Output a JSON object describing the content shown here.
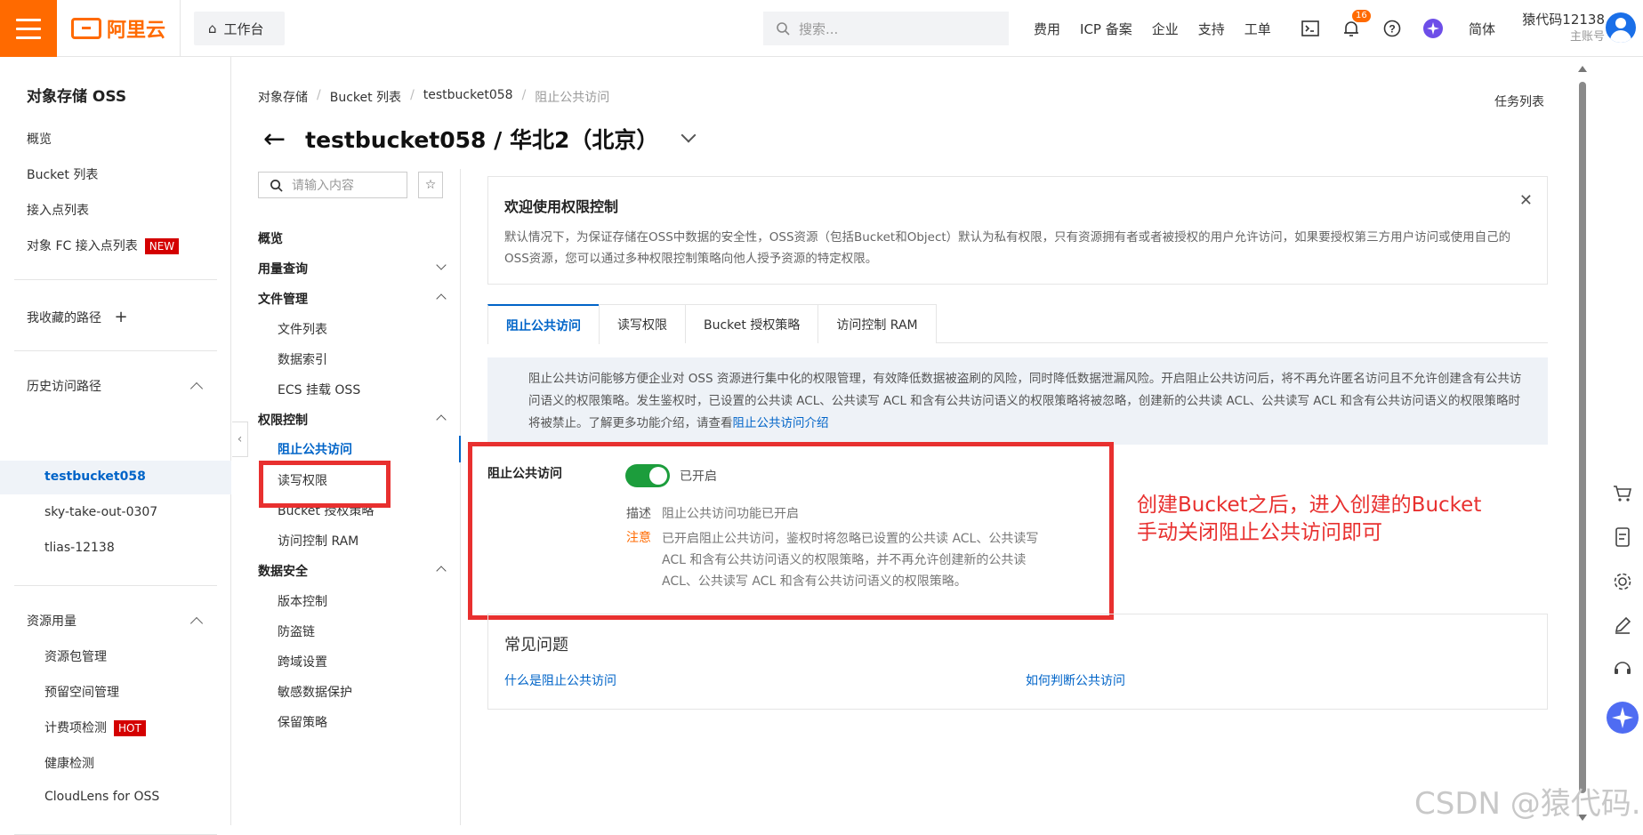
{
  "topbar": {
    "logo_text": "阿里云",
    "workbench": "工作台",
    "search_placeholder": "搜索...",
    "links": [
      "费用",
      "ICP 备案",
      "企业",
      "支持",
      "工单"
    ],
    "notification_count": "16",
    "language": "简体",
    "username": "猿代码12138",
    "account_type": "主账号"
  },
  "sidebar": {
    "title": "对象存储 OSS",
    "items": [
      "概览",
      "Bucket 列表",
      "接入点列表",
      "对象 FC 接入点列表"
    ],
    "new_tag": "NEW",
    "favorites": "我收藏的路径",
    "history_title": "历史访问路径",
    "history": [
      "testbucket058",
      "sky-take-out-0307",
      "tlias-12138"
    ],
    "resources_title": "资源用量",
    "resources": [
      "资源包管理",
      "预留空间管理",
      "计费项检测",
      "健康检测",
      "CloudLens for OSS"
    ],
    "hot_tag": "HOT"
  },
  "breadcrumb": [
    "对象存储",
    "Bucket 列表",
    "testbucket058",
    "阻止公共访问"
  ],
  "tasklist": "任务列表",
  "page_title": "testbucket058 / 华北2（北京）",
  "subnav": {
    "search_placeholder": "请输入内容",
    "overview": "概览",
    "usage": "用量查询",
    "file_mgmt": "文件管理",
    "file_items": [
      "文件列表",
      "数据索引",
      "ECS 挂载 OSS"
    ],
    "perm": "权限控制",
    "perm_items": [
      "阻止公共访问",
      "读写权限",
      "Bucket 授权策略",
      "访问控制 RAM"
    ],
    "data_security": "数据安全",
    "sec_items": [
      "版本控制",
      "防盗链",
      "跨域设置",
      "敏感数据保护",
      "保留策略"
    ]
  },
  "welcome": {
    "title": "欢迎使用权限控制",
    "body": "默认情况下，为保证存储在OSS中数据的安全性，OSS资源（包括Bucket和Object）默认为私有权限，只有资源拥有者或者被授权的用户允许访问，如果要授权第三方用户访问或使用自己的OSS资源，您可以通过多种权限控制策略向他人授予资源的特定权限。"
  },
  "tabs": [
    "阻止公共访问",
    "读写权限",
    "Bucket 授权策略",
    "访问控制 RAM"
  ],
  "notice": {
    "text": "阻止公共访问能够方便企业对 OSS 资源进行集中化的权限管理，有效降低数据被盗刷的风险，同时降低数据泄漏风险。开启阻止公共访问后，将不再允许匿名访问且不允许创建含有公共访问语义的权限策略。发生鉴权时，已设置的公共读 ACL、公共读写 ACL 和含有公共访问语义的权限策略将被忽略，创建新的公共读 ACL、公共读写 ACL 和含有公共访问语义的权限策略时将被禁止。了解更多功能介绍，请查看",
    "link": "阻止公共访问介绍"
  },
  "setting": {
    "label": "阻止公共访问",
    "state": "已开启",
    "enabled": true,
    "desc_label": "描述",
    "desc": "阻止公共访问功能已开启",
    "note_label": "注意",
    "note": "已开启阻止公共访问，鉴权时将忽略已设置的公共读 ACL、公共读写 ACL 和含有公共访问语义的权限策略，并不再允许创建新的公共读 ACL、公共读写 ACL 和含有公共访问语义的权限策略。"
  },
  "annotation": {
    "line1": "创建Bucket之后，进入创建的Bucket",
    "line2": "手动关闭阻止公共访问即可"
  },
  "faq": {
    "title": "常见问题",
    "q1": "什么是阻止公共访问",
    "q2": "如何判断公共访问"
  },
  "watermark": "CSDN @猿代码."
}
